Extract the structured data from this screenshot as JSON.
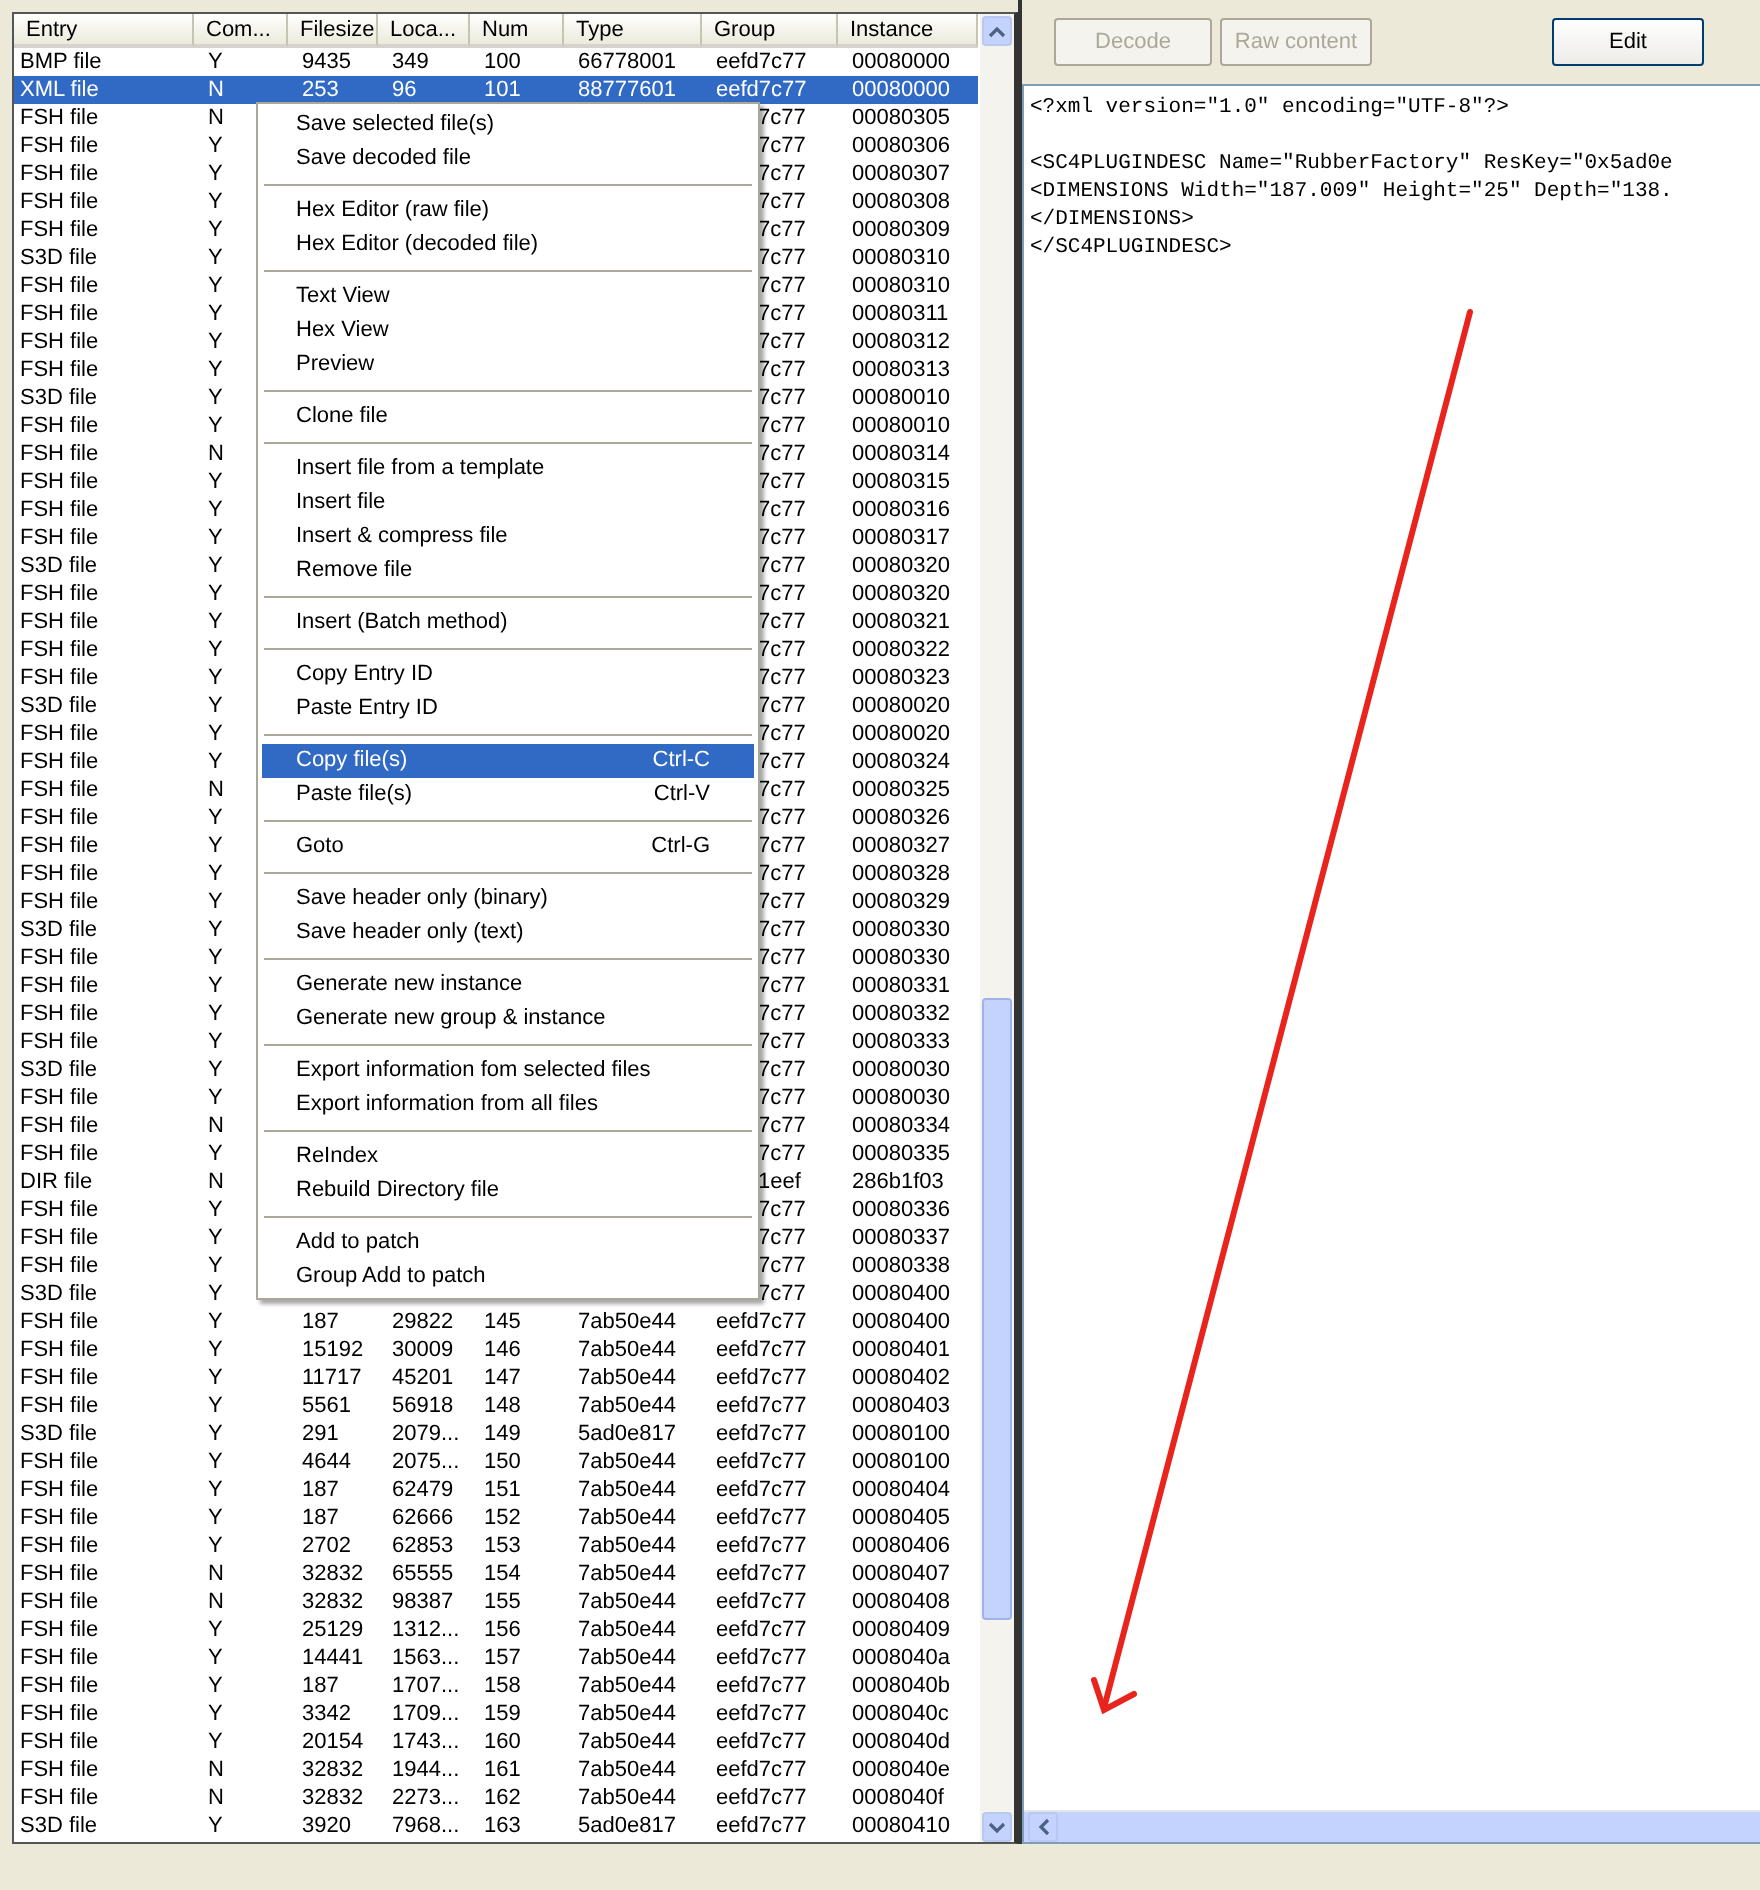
{
  "list": {
    "columns": [
      "Entry",
      "Com...",
      "Filesize",
      "Loca...",
      "Num",
      "Type",
      "Group",
      "Instance"
    ],
    "rows": [
      {
        "kind": "full",
        "selected": false,
        "entry": "BMP file",
        "compressed": "Y",
        "filesize": "9435",
        "location": "349",
        "num": "100",
        "type": "66778001",
        "group": "eefd7c77",
        "instance": "00080000"
      },
      {
        "kind": "full",
        "selected": true,
        "entry": "XML file",
        "compressed": "N",
        "filesize": "253",
        "location": "96",
        "num": "101",
        "type": "88777601",
        "group": "eefd7c77",
        "instance": "00080000"
      },
      {
        "kind": "partial",
        "selected": false,
        "entry": "FSH file",
        "compressed": "N",
        "group": "7c77",
        "instance": "00080305"
      },
      {
        "kind": "partial",
        "selected": false,
        "entry": "FSH file",
        "compressed": "Y",
        "group": "7c77",
        "instance": "00080306"
      },
      {
        "kind": "partial",
        "selected": false,
        "entry": "FSH file",
        "compressed": "Y",
        "group": "7c77",
        "instance": "00080307"
      },
      {
        "kind": "partial",
        "selected": false,
        "entry": "FSH file",
        "compressed": "Y",
        "group": "7c77",
        "instance": "00080308"
      },
      {
        "kind": "partial",
        "selected": false,
        "entry": "FSH file",
        "compressed": "Y",
        "group": "7c77",
        "instance": "00080309"
      },
      {
        "kind": "partial",
        "selected": false,
        "entry": "S3D file",
        "compressed": "Y",
        "group": "7c77",
        "instance": "00080310"
      },
      {
        "kind": "partial",
        "selected": false,
        "entry": "FSH file",
        "compressed": "Y",
        "group": "7c77",
        "instance": "00080310"
      },
      {
        "kind": "partial",
        "selected": false,
        "entry": "FSH file",
        "compressed": "Y",
        "group": "7c77",
        "instance": "00080311"
      },
      {
        "kind": "partial",
        "selected": false,
        "entry": "FSH file",
        "compressed": "Y",
        "group": "7c77",
        "instance": "00080312"
      },
      {
        "kind": "partial",
        "selected": false,
        "entry": "FSH file",
        "compressed": "Y",
        "group": "7c77",
        "instance": "00080313"
      },
      {
        "kind": "partial",
        "selected": false,
        "entry": "S3D file",
        "compressed": "Y",
        "group": "7c77",
        "instance": "00080010"
      },
      {
        "kind": "partial",
        "selected": false,
        "entry": "FSH file",
        "compressed": "Y",
        "group": "7c77",
        "instance": "00080010"
      },
      {
        "kind": "partial",
        "selected": false,
        "entry": "FSH file",
        "compressed": "N",
        "group": "7c77",
        "instance": "00080314"
      },
      {
        "kind": "partial",
        "selected": false,
        "entry": "FSH file",
        "compressed": "Y",
        "group": "7c77",
        "instance": "00080315"
      },
      {
        "kind": "partial",
        "selected": false,
        "entry": "FSH file",
        "compressed": "Y",
        "group": "7c77",
        "instance": "00080316"
      },
      {
        "kind": "partial",
        "selected": false,
        "entry": "FSH file",
        "compressed": "Y",
        "group": "7c77",
        "instance": "00080317"
      },
      {
        "kind": "partial",
        "selected": false,
        "entry": "S3D file",
        "compressed": "Y",
        "group": "7c77",
        "instance": "00080320"
      },
      {
        "kind": "partial",
        "selected": false,
        "entry": "FSH file",
        "compressed": "Y",
        "group": "7c77",
        "instance": "00080320"
      },
      {
        "kind": "partial",
        "selected": false,
        "entry": "FSH file",
        "compressed": "Y",
        "group": "7c77",
        "instance": "00080321"
      },
      {
        "kind": "partial",
        "selected": false,
        "entry": "FSH file",
        "compressed": "Y",
        "group": "7c77",
        "instance": "00080322"
      },
      {
        "kind": "partial",
        "selected": false,
        "entry": "FSH file",
        "compressed": "Y",
        "group": "7c77",
        "instance": "00080323"
      },
      {
        "kind": "partial",
        "selected": false,
        "entry": "S3D file",
        "compressed": "Y",
        "group": "7c77",
        "instance": "00080020"
      },
      {
        "kind": "partial",
        "selected": false,
        "entry": "FSH file",
        "compressed": "Y",
        "group": "7c77",
        "instance": "00080020"
      },
      {
        "kind": "partial",
        "selected": false,
        "entry": "FSH file",
        "compressed": "Y",
        "group": "7c77",
        "instance": "00080324"
      },
      {
        "kind": "partial",
        "selected": false,
        "entry": "FSH file",
        "compressed": "N",
        "group": "7c77",
        "instance": "00080325"
      },
      {
        "kind": "partial",
        "selected": false,
        "entry": "FSH file",
        "compressed": "Y",
        "group": "7c77",
        "instance": "00080326"
      },
      {
        "kind": "partial",
        "selected": false,
        "entry": "FSH file",
        "compressed": "Y",
        "group": "7c77",
        "instance": "00080327"
      },
      {
        "kind": "partial",
        "selected": false,
        "entry": "FSH file",
        "compressed": "Y",
        "group": "7c77",
        "instance": "00080328"
      },
      {
        "kind": "partial",
        "selected": false,
        "entry": "FSH file",
        "compressed": "Y",
        "group": "7c77",
        "instance": "00080329"
      },
      {
        "kind": "partial",
        "selected": false,
        "entry": "S3D file",
        "compressed": "Y",
        "group": "7c77",
        "instance": "00080330"
      },
      {
        "kind": "partial",
        "selected": false,
        "entry": "FSH file",
        "compressed": "Y",
        "group": "7c77",
        "instance": "00080330"
      },
      {
        "kind": "partial",
        "selected": false,
        "entry": "FSH file",
        "compressed": "Y",
        "group": "7c77",
        "instance": "00080331"
      },
      {
        "kind": "partial",
        "selected": false,
        "entry": "FSH file",
        "compressed": "Y",
        "group": "7c77",
        "instance": "00080332"
      },
      {
        "kind": "partial",
        "selected": false,
        "entry": "FSH file",
        "compressed": "Y",
        "group": "7c77",
        "instance": "00080333"
      },
      {
        "kind": "partial",
        "selected": false,
        "entry": "S3D file",
        "compressed": "Y",
        "group": "7c77",
        "instance": "00080030"
      },
      {
        "kind": "partial",
        "selected": false,
        "entry": "FSH file",
        "compressed": "Y",
        "group": "7c77",
        "instance": "00080030"
      },
      {
        "kind": "partial",
        "selected": false,
        "entry": "FSH file",
        "compressed": "N",
        "group": "7c77",
        "instance": "00080334"
      },
      {
        "kind": "partial",
        "selected": false,
        "entry": "FSH file",
        "compressed": "Y",
        "group": "7c77",
        "instance": "00080335"
      },
      {
        "kind": "partial",
        "selected": false,
        "entry": "DIR file",
        "compressed": "N",
        "group": "1eef",
        "instance": "286b1f03"
      },
      {
        "kind": "partial",
        "selected": false,
        "entry": "FSH file",
        "compressed": "Y",
        "group": "7c77",
        "instance": "00080336"
      },
      {
        "kind": "partial",
        "selected": false,
        "entry": "FSH file",
        "compressed": "Y",
        "group": "7c77",
        "instance": "00080337"
      },
      {
        "kind": "partial",
        "selected": false,
        "entry": "FSH file",
        "compressed": "Y",
        "group": "7c77",
        "instance": "00080338"
      },
      {
        "kind": "partial",
        "selected": false,
        "entry": "S3D file",
        "compressed": "Y",
        "group": "7c77",
        "instance": "00080400"
      },
      {
        "kind": "full",
        "selected": false,
        "entry": "FSH file",
        "compressed": "Y",
        "filesize": "187",
        "location": "29822",
        "num": "145",
        "type": "7ab50e44",
        "group": "eefd7c77",
        "instance": "00080400"
      },
      {
        "kind": "full",
        "selected": false,
        "entry": "FSH file",
        "compressed": "Y",
        "filesize": "15192",
        "location": "30009",
        "num": "146",
        "type": "7ab50e44",
        "group": "eefd7c77",
        "instance": "00080401"
      },
      {
        "kind": "full",
        "selected": false,
        "entry": "FSH file",
        "compressed": "Y",
        "filesize": "11717",
        "location": "45201",
        "num": "147",
        "type": "7ab50e44",
        "group": "eefd7c77",
        "instance": "00080402"
      },
      {
        "kind": "full",
        "selected": false,
        "entry": "FSH file",
        "compressed": "Y",
        "filesize": "5561",
        "location": "56918",
        "num": "148",
        "type": "7ab50e44",
        "group": "eefd7c77",
        "instance": "00080403"
      },
      {
        "kind": "full",
        "selected": false,
        "entry": "S3D file",
        "compressed": "Y",
        "filesize": "291",
        "location": "2079...",
        "num": "149",
        "type": "5ad0e817",
        "group": "eefd7c77",
        "instance": "00080100"
      },
      {
        "kind": "full",
        "selected": false,
        "entry": "FSH file",
        "compressed": "Y",
        "filesize": "4644",
        "location": "2075...",
        "num": "150",
        "type": "7ab50e44",
        "group": "eefd7c77",
        "instance": "00080100"
      },
      {
        "kind": "full",
        "selected": false,
        "entry": "FSH file",
        "compressed": "Y",
        "filesize": "187",
        "location": "62479",
        "num": "151",
        "type": "7ab50e44",
        "group": "eefd7c77",
        "instance": "00080404"
      },
      {
        "kind": "full",
        "selected": false,
        "entry": "FSH file",
        "compressed": "Y",
        "filesize": "187",
        "location": "62666",
        "num": "152",
        "type": "7ab50e44",
        "group": "eefd7c77",
        "instance": "00080405"
      },
      {
        "kind": "full",
        "selected": false,
        "entry": "FSH file",
        "compressed": "Y",
        "filesize": "2702",
        "location": "62853",
        "num": "153",
        "type": "7ab50e44",
        "group": "eefd7c77",
        "instance": "00080406"
      },
      {
        "kind": "full",
        "selected": false,
        "entry": "FSH file",
        "compressed": "N",
        "filesize": "32832",
        "location": "65555",
        "num": "154",
        "type": "7ab50e44",
        "group": "eefd7c77",
        "instance": "00080407"
      },
      {
        "kind": "full",
        "selected": false,
        "entry": "FSH file",
        "compressed": "N",
        "filesize": "32832",
        "location": "98387",
        "num": "155",
        "type": "7ab50e44",
        "group": "eefd7c77",
        "instance": "00080408"
      },
      {
        "kind": "full",
        "selected": false,
        "entry": "FSH file",
        "compressed": "Y",
        "filesize": "25129",
        "location": "1312...",
        "num": "156",
        "type": "7ab50e44",
        "group": "eefd7c77",
        "instance": "00080409"
      },
      {
        "kind": "full",
        "selected": false,
        "entry": "FSH file",
        "compressed": "Y",
        "filesize": "14441",
        "location": "1563...",
        "num": "157",
        "type": "7ab50e44",
        "group": "eefd7c77",
        "instance": "0008040a"
      },
      {
        "kind": "full",
        "selected": false,
        "entry": "FSH file",
        "compressed": "Y",
        "filesize": "187",
        "location": "1707...",
        "num": "158",
        "type": "7ab50e44",
        "group": "eefd7c77",
        "instance": "0008040b"
      },
      {
        "kind": "full",
        "selected": false,
        "entry": "FSH file",
        "compressed": "Y",
        "filesize": "3342",
        "location": "1709...",
        "num": "159",
        "type": "7ab50e44",
        "group": "eefd7c77",
        "instance": "0008040c"
      },
      {
        "kind": "full",
        "selected": false,
        "entry": "FSH file",
        "compressed": "Y",
        "filesize": "20154",
        "location": "1743...",
        "num": "160",
        "type": "7ab50e44",
        "group": "eefd7c77",
        "instance": "0008040d"
      },
      {
        "kind": "full",
        "selected": false,
        "entry": "FSH file",
        "compressed": "N",
        "filesize": "32832",
        "location": "1944...",
        "num": "161",
        "type": "7ab50e44",
        "group": "eefd7c77",
        "instance": "0008040e"
      },
      {
        "kind": "full",
        "selected": false,
        "entry": "FSH file",
        "compressed": "N",
        "filesize": "32832",
        "location": "2273...",
        "num": "162",
        "type": "7ab50e44",
        "group": "eefd7c77",
        "instance": "0008040f"
      },
      {
        "kind": "full",
        "selected": false,
        "entry": "S3D file",
        "compressed": "Y",
        "filesize": "3920",
        "location": "7968...",
        "num": "163",
        "type": "5ad0e817",
        "group": "eefd7c77",
        "instance": "00080410"
      }
    ]
  },
  "context_menu": {
    "groups": [
      {
        "items": [
          {
            "label": "Save selected file(s)",
            "selected": false
          },
          {
            "label": "Save decoded file",
            "selected": false
          }
        ]
      },
      {
        "items": [
          {
            "label": "Hex Editor (raw file)",
            "selected": false
          },
          {
            "label": "Hex Editor (decoded file)",
            "selected": false
          }
        ]
      },
      {
        "items": [
          {
            "label": "Text View",
            "selected": false
          },
          {
            "label": "Hex View",
            "selected": false
          },
          {
            "label": "Preview",
            "selected": false
          }
        ]
      },
      {
        "items": [
          {
            "label": "Clone file",
            "selected": false
          }
        ]
      },
      {
        "items": [
          {
            "label": "Insert file from a template",
            "selected": false
          },
          {
            "label": "Insert file",
            "selected": false
          },
          {
            "label": "Insert & compress file",
            "selected": false
          },
          {
            "label": "Remove file",
            "selected": false
          }
        ]
      },
      {
        "items": [
          {
            "label": "Insert (Batch method)",
            "selected": false
          }
        ]
      },
      {
        "items": [
          {
            "label": "Copy Entry ID",
            "selected": false
          },
          {
            "label": "Paste Entry ID",
            "selected": false
          }
        ]
      },
      {
        "items": [
          {
            "label": "Copy file(s)",
            "shortcut": "Ctrl-C",
            "selected": true
          },
          {
            "label": "Paste file(s)",
            "shortcut": "Ctrl-V",
            "selected": false
          }
        ]
      },
      {
        "items": [
          {
            "label": "Goto",
            "shortcut": "Ctrl-G",
            "selected": false
          }
        ]
      },
      {
        "items": [
          {
            "label": "Save header only (binary)",
            "selected": false
          },
          {
            "label": "Save header only (text)",
            "selected": false
          }
        ]
      },
      {
        "items": [
          {
            "label": "Generate new instance",
            "selected": false
          },
          {
            "label": "Generate new group & instance",
            "selected": false
          }
        ]
      },
      {
        "items": [
          {
            "label": "Export information fom selected files",
            "selected": false
          },
          {
            "label": "Export information from all files",
            "selected": false
          }
        ]
      },
      {
        "items": [
          {
            "label": "ReIndex",
            "selected": false
          },
          {
            "label": "Rebuild Directory file",
            "selected": false
          }
        ]
      },
      {
        "items": [
          {
            "label": "Add to patch",
            "selected": false
          },
          {
            "label": "Group Add to patch",
            "selected": false
          }
        ]
      }
    ]
  },
  "viewer": {
    "buttons": [
      {
        "label": "Decode",
        "disabled": true
      },
      {
        "label": "Raw content",
        "disabled": true
      },
      {
        "label": "Edit",
        "disabled": false
      }
    ],
    "blocks": [
      {
        "lines": [
          "<?xml version=\"1.0\" encoding=\"UTF-8\"?>"
        ]
      },
      {
        "lines": [
          "<SC4PLUGINDESC Name=\"RubberFactory\" ResKey=\"0x5ad0e",
          "<DIMENSIONS Width=\"187.009\" Height=\"25\" Depth=\"138.",
          "</DIMENSIONS>",
          "</SC4PLUGINDESC>"
        ]
      }
    ]
  }
}
